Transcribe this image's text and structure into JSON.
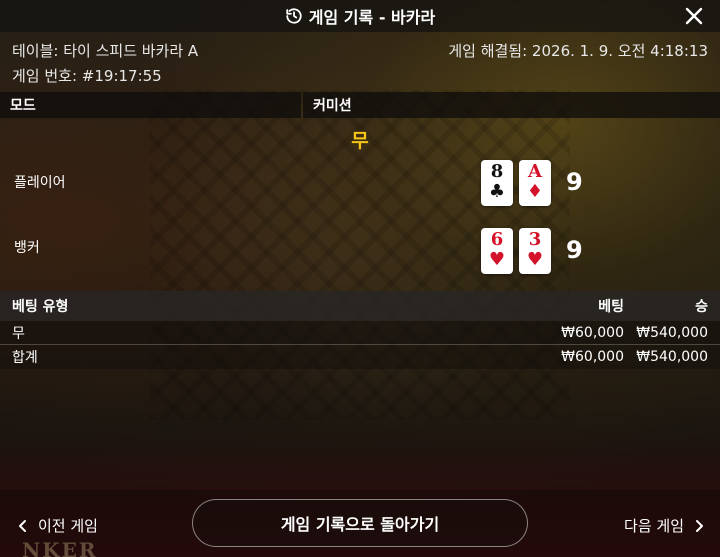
{
  "header": {
    "title": "게임 기록 - 바카라",
    "history_icon": "history-icon",
    "close_icon": "close-icon"
  },
  "info": {
    "table": "테이블: 타이 스피드 바카라 A",
    "resolved": "게임 해결됨: 2026. 1. 9. 오전 4:18:13",
    "game_number": "게임 번호: #19:17:55"
  },
  "section": {
    "mode_label": "모드",
    "commission_label": "커미션"
  },
  "result": {
    "outcome": "무",
    "player": {
      "label": "플레이어",
      "score": "9",
      "cards": [
        {
          "rank": "8",
          "suit": "♣",
          "color": "black"
        },
        {
          "rank": "A",
          "suit": "♦",
          "color": "red"
        }
      ]
    },
    "banker": {
      "label": "뱅커",
      "score": "9",
      "cards": [
        {
          "rank": "6",
          "suit": "♥",
          "color": "red"
        },
        {
          "rank": "3",
          "suit": "♥",
          "color": "red"
        }
      ]
    }
  },
  "bets": {
    "headers": [
      "베팅 유형",
      "베팅",
      "승"
    ],
    "rows": [
      {
        "type": "무",
        "bet": "₩60,000",
        "win": "₩540,000"
      }
    ],
    "total": {
      "type": "합계",
      "bet": "₩60,000",
      "win": "₩540,000"
    }
  },
  "footer": {
    "prev_label": "이전 게임",
    "back_label": "게임 기록으로 돌아가기",
    "next_label": "다음 게임"
  },
  "background_text": "NKER",
  "colors": {
    "outcome": "#f5c518",
    "red_suit": "#d4122a"
  }
}
